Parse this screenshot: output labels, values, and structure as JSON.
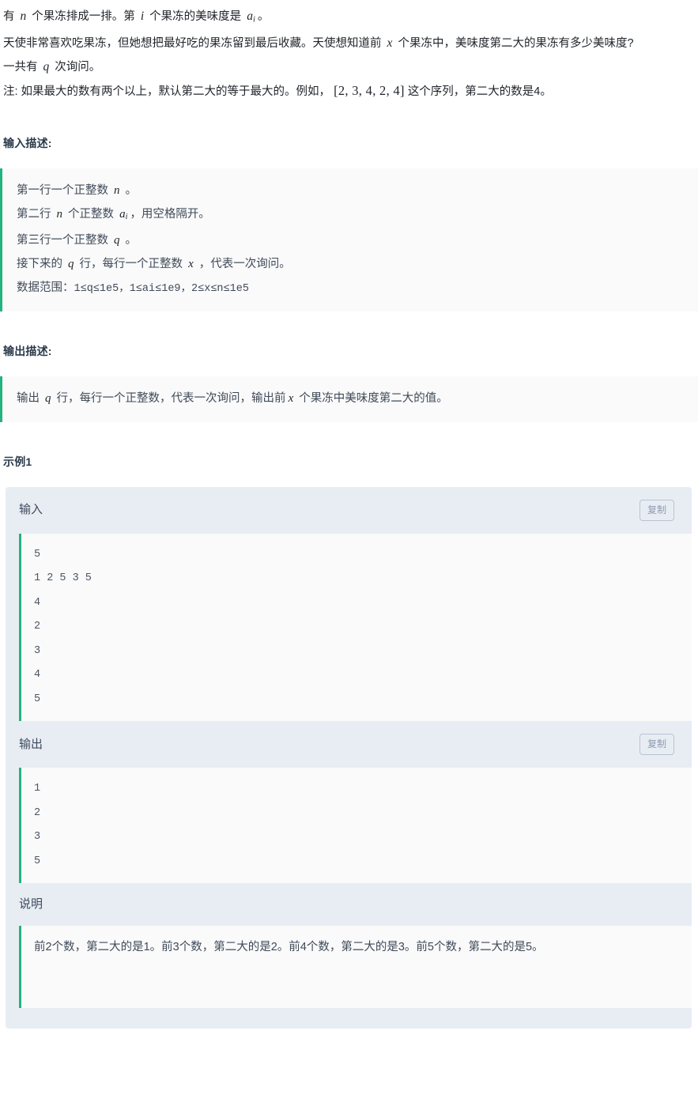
{
  "statement": {
    "lines": [
      {
        "parts": [
          {
            "t": "text",
            "v": "有 "
          },
          {
            "t": "math",
            "v": "n"
          },
          {
            "t": "text",
            "v": " 个果冻排成一排。第 "
          },
          {
            "t": "math",
            "v": "i"
          },
          {
            "t": "text",
            "v": " 个果冻的美味度是 "
          },
          {
            "t": "math",
            "v": "a",
            "sub": "i"
          },
          {
            "t": "text",
            "v": "。"
          }
        ]
      },
      {
        "parts": [
          {
            "t": "text",
            "v": "天使非常喜欢吃果冻，但她想把最好吃的果冻留到最后收藏。天使想知道前 "
          },
          {
            "t": "math",
            "v": "x"
          },
          {
            "t": "text",
            "v": " 个果冻中，美味度第二大的果冻有多少美味度?"
          }
        ]
      },
      {
        "parts": [
          {
            "t": "text",
            "v": "一共有 "
          },
          {
            "t": "math",
            "v": "q"
          },
          {
            "t": "text",
            "v": " 次询问。"
          }
        ]
      },
      {
        "parts": [
          {
            "t": "text",
            "v": "注: 如果最大的数有两个以上，默认第二大的等于最大的。例如，"
          },
          {
            "t": "bracket",
            "v": "[2, 3, 4, 2, 4]"
          },
          {
            "t": "text",
            "v": "这个序列，第二大的数是4。"
          }
        ]
      }
    ]
  },
  "input_section": {
    "title": "输入描述:",
    "lines": [
      [
        {
          "t": "cn",
          "v": "第一行一个正整数 "
        },
        {
          "t": "math",
          "v": "n"
        },
        {
          "t": "cn",
          "v": " 。"
        }
      ],
      [
        {
          "t": "cn",
          "v": "第二行 "
        },
        {
          "t": "math",
          "v": "n"
        },
        {
          "t": "cn",
          "v": " 个正整数 "
        },
        {
          "t": "math",
          "v": "a",
          "sub": "i"
        },
        {
          "t": "cn",
          "v": "，用空格隔开。"
        }
      ],
      [
        {
          "t": "cn",
          "v": "第三行一个正整数 "
        },
        {
          "t": "math",
          "v": "q"
        },
        {
          "t": "cn",
          "v": " 。"
        }
      ],
      [
        {
          "t": "cn",
          "v": "接下来的 "
        },
        {
          "t": "math",
          "v": "q"
        },
        {
          "t": "cn",
          "v": " 行，每行一个正整数 "
        },
        {
          "t": "math",
          "v": "x"
        },
        {
          "t": "cn",
          "v": " ，代表一次询问。"
        }
      ],
      [
        {
          "t": "cn",
          "v": "数据范围："
        },
        {
          "t": "mono",
          "v": "1≤q≤1e5，1≤ai≤1e9，2≤x≤n≤1e5"
        }
      ]
    ]
  },
  "output_section": {
    "title": "输出描述:",
    "lines": [
      [
        {
          "t": "cn",
          "v": "输出 "
        },
        {
          "t": "math",
          "v": "q"
        },
        {
          "t": "cn",
          "v": " 行，每行一个正整数，代表一次询问，输出前"
        },
        {
          "t": "math",
          "v": "x"
        },
        {
          "t": "cn",
          "v": " 个果冻中美味度第二大的值。"
        }
      ]
    ]
  },
  "example": {
    "title": "示例1",
    "input_label": "输入",
    "input_copy_label": "复制",
    "input_code": "5\n1 2 5 3 5\n4\n2\n3\n4\n5",
    "output_label": "输出",
    "output_copy_label": "复制",
    "output_code": "1\n2\n3\n5",
    "note_label": "说明",
    "note_lines": [
      "前2个数，第二大的是1。",
      "前3个数，第二大的是2。",
      "前4个数，第二大的是3。",
      "前5个数，第二大的是5。"
    ]
  },
  "colors": {
    "accent_green": "#24b37e",
    "card_bg": "#e8edf4",
    "code_bg": "#fafafa",
    "heading": "#2b3a4a"
  }
}
